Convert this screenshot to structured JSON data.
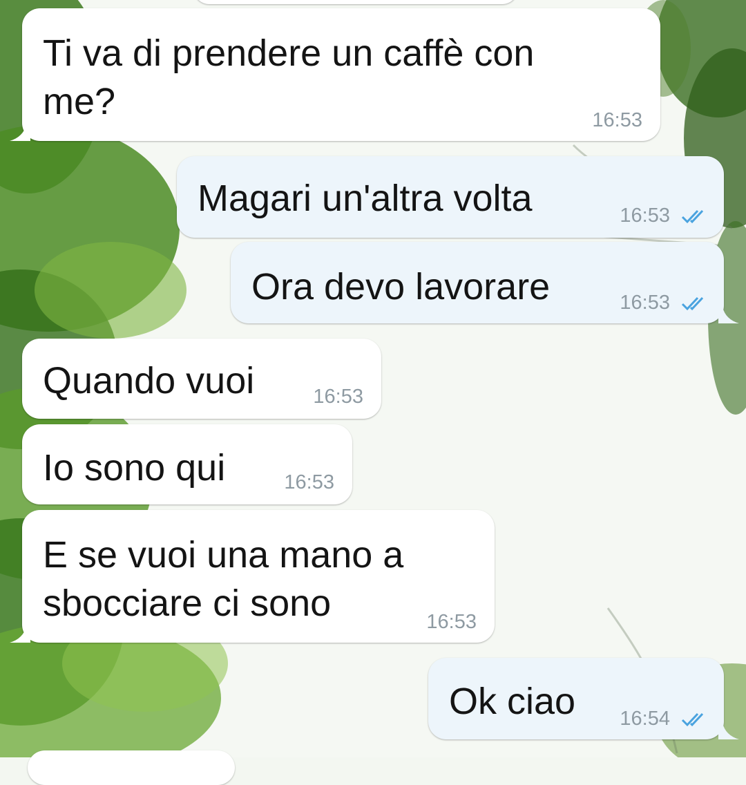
{
  "colors": {
    "incoming_bubble": "#ffffff",
    "outgoing_bubble": "#edf5fb",
    "time_text": "#8e9aa2",
    "read_ticks": "#4aa3df"
  },
  "messages": [
    {
      "id": "m1",
      "direction": "incoming",
      "text": "Ti va di prendere un caffè con\nme?",
      "time": "16:53"
    },
    {
      "id": "m2",
      "direction": "outgoing",
      "text": "Magari un'altra volta",
      "time": "16:53",
      "status_icon": "double-check-icon"
    },
    {
      "id": "m3",
      "direction": "outgoing",
      "text": "Ora devo lavorare",
      "time": "16:53",
      "status_icon": "double-check-icon"
    },
    {
      "id": "m4",
      "direction": "incoming",
      "text": "Quando vuoi",
      "time": "16:53"
    },
    {
      "id": "m5",
      "direction": "incoming",
      "text": "Io sono qui",
      "time": "16:53"
    },
    {
      "id": "m6",
      "direction": "incoming",
      "text": "E se vuoi una mano a\nsbocciare ci sono",
      "time": "16:53"
    },
    {
      "id": "m7",
      "direction": "outgoing",
      "text": "Ok ciao",
      "time": "16:54",
      "status_icon": "double-check-icon"
    }
  ]
}
